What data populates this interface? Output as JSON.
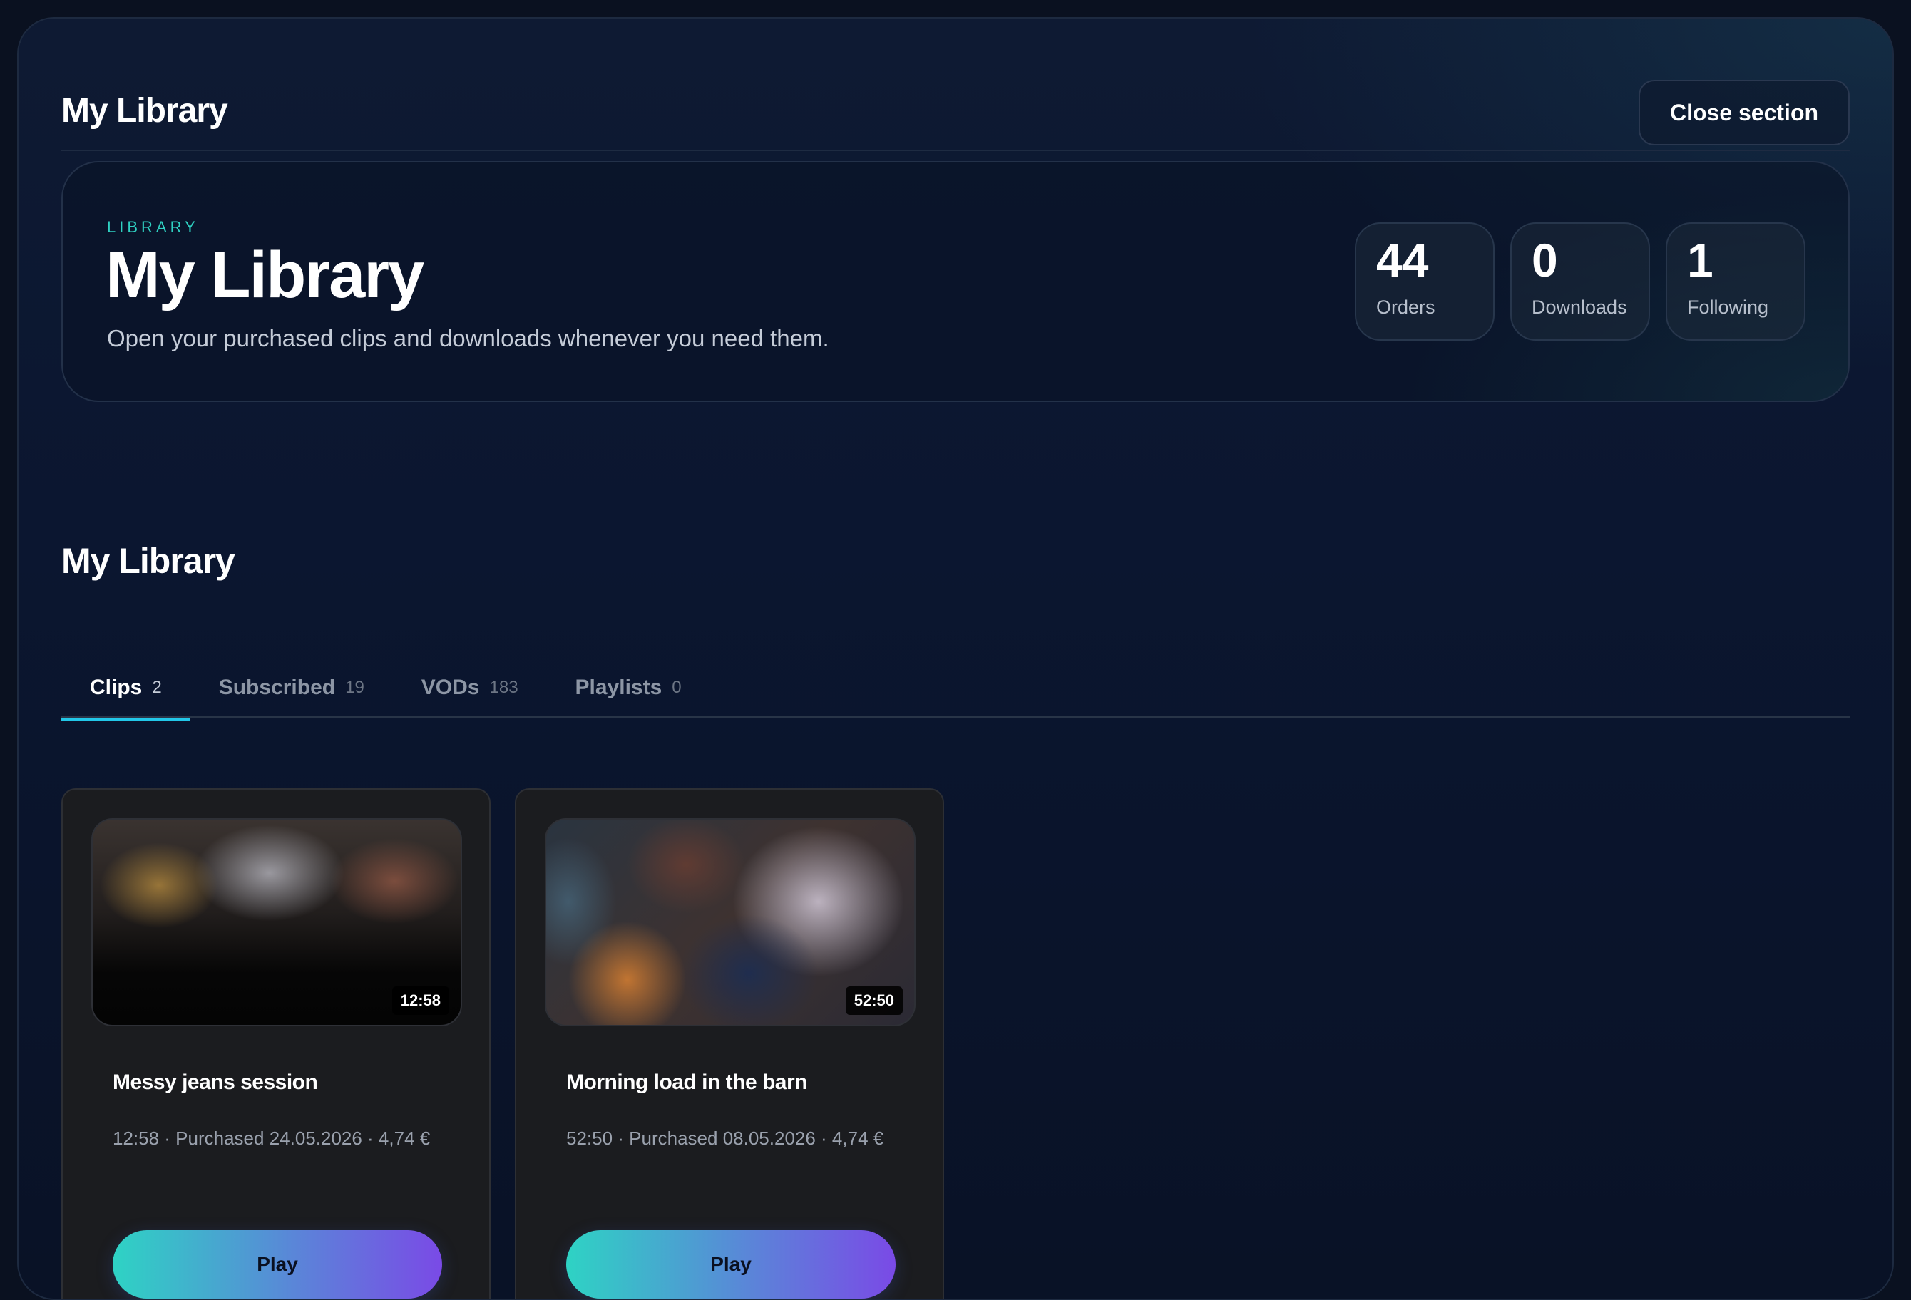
{
  "header": {
    "title": "My Library",
    "close_label": "Close section"
  },
  "hero": {
    "eyebrow": "LIBRARY",
    "title": "My Library",
    "subtitle": "Open your purchased clips and downloads whenever you need them.",
    "stats": [
      {
        "value": "44",
        "label": "Orders"
      },
      {
        "value": "0",
        "label": "Downloads"
      },
      {
        "value": "1",
        "label": "Following"
      }
    ]
  },
  "section": {
    "title": "My Library"
  },
  "tabs": [
    {
      "label": "Clips",
      "count": "2",
      "active": true
    },
    {
      "label": "Subscribed",
      "count": "19",
      "active": false
    },
    {
      "label": "VODs",
      "count": "183",
      "active": false
    },
    {
      "label": "Playlists",
      "count": "0",
      "active": false
    }
  ],
  "clips": [
    {
      "title": "Messy jeans session",
      "duration": "12:58",
      "meta": "12:58 · Purchased 24.05.2026 · 4,74 €",
      "play_label": "Play"
    },
    {
      "title": "Morning load in the barn",
      "duration": "52:50",
      "meta": "52:50 · Purchased 08.05.2026 · 4,74 €",
      "play_label": "Play"
    }
  ],
  "colors": {
    "accent_teal": "#2fd1c2",
    "tab_underline": "#22c7e8",
    "play_gradient_start": "#2ed3c4",
    "play_gradient_end": "#7a4ae6"
  }
}
